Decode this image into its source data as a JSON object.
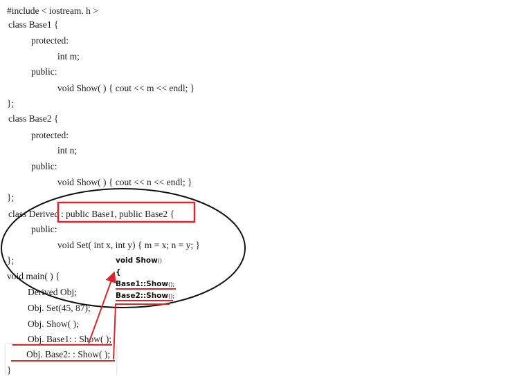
{
  "code_lines": [
    "#include < iostream. h >",
    "class Base1 {",
    "protected:",
    "int m;",
    "public:",
    "void Show( ) { cout << m << endl; }",
    "};",
    "class Base2 {",
    "protected:",
    "int n;",
    "public:",
    "void Show( ) { cout << n << endl; }",
    "};",
    "class Derived",
    ": public Base1, public Base2 {",
    "public:",
    "void Set( int x, int y) { m = x; n = y; }",
    "};",
    "void main( ) {",
    "Derived Obj;",
    "Obj. Set(45, 87);",
    "Obj. Show( );",
    "Obj. Base1: : Show( );",
    "Obj. Base2: : Show( );",
    "}"
  ],
  "annotation": {
    "line1": "void Show",
    "line2": "{",
    "line3_name": "Base1",
    "line3_rest": "::Show",
    "line4_name": "Base2",
    "line4_rest": "::Show",
    "paren": "()",
    "call_end": "();"
  },
  "colors": {
    "highlight": "#d9262b",
    "ellipse": "#111111",
    "text": "#1a1a1a"
  }
}
